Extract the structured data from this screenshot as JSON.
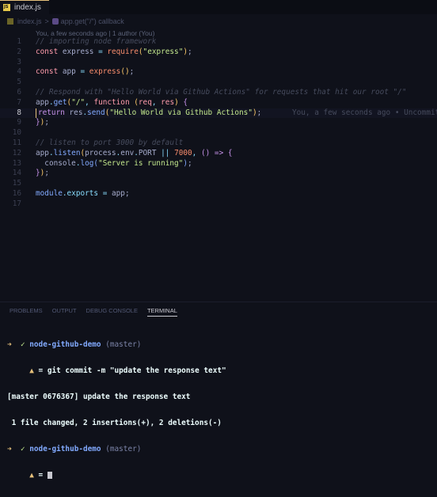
{
  "tab": {
    "label": "index.js"
  },
  "breadcrumb": {
    "file": "index.js",
    "separator": ">",
    "symbol": "app.get(\"/\") callback"
  },
  "blame_header": "You, a few seconds ago | 1 author (You)",
  "editor": {
    "line_numbers": [
      "1",
      "2",
      "3",
      "4",
      "5",
      "6",
      "7",
      "8",
      "9",
      "10",
      "11",
      "12",
      "13",
      "14",
      "15",
      "16",
      "17"
    ],
    "active_line": "8",
    "line8_blame": "You, a few seconds ago • Uncommit",
    "tokens": {
      "l1_comment": "// importing node framework",
      "kw_const": "const",
      "l2_express": "express",
      "eq": "=",
      "l2_require": "require",
      "paren_open": "(",
      "paren_close": ")",
      "l2_str": "\"express\"",
      "semi": ";",
      "l4_app": "app",
      "l4_express": "express",
      "l4_call": "()",
      "l6_comment": "// Respond with \"Hello World via Github Actions\" for requests that hit our root \"/\"",
      "l7_app": "app",
      "dot": ".",
      "l7_get": "get",
      "l7_str": "\"/\"",
      "comma": ",",
      "l7_function": "function",
      "l7_req": "req",
      "l7_res": "res",
      "brace_open": "{",
      "brace_close": "}",
      "l8_return": "return",
      "l8_res": "res",
      "l8_send": "send",
      "l8_str": "\"Hello World via Github Actions\"",
      "l11_comment": "// listen to port 3000 by default",
      "l12_app": "app",
      "l12_listen": "listen",
      "l12_process": "process",
      "l12_env": "env",
      "l12_port": "PORT",
      "l12_or": "||",
      "l12_num": "7000",
      "l12_arrow": "=>",
      "l13_console": "console",
      "l13_log": "log",
      "l13_str": "\"Server is running\"",
      "l16_module": "module",
      "l16_exports": "exports",
      "l16_app": "app"
    }
  },
  "panel": {
    "tabs": [
      "PROBLEMS",
      "OUTPUT",
      "DEBUG CONSOLE",
      "TERMINAL"
    ],
    "active_tab": "TERMINAL"
  },
  "terminal": {
    "arrow": "➜",
    "check": "✓",
    "dir": "node-github-demo",
    "branch": "(master)",
    "warn": "▲",
    "prompt_sym": "=",
    "command": "git commit -m \"update the response text\"",
    "out1": "[master 0676367] update the response text",
    "out2": " 1 file changed, 2 insertions(+), 2 deletions(-)"
  },
  "colors": {
    "background": "#0f111a",
    "keyword": "#c792ea",
    "string": "#c3e88d",
    "function": "#82aaff",
    "number": "#f78c6c",
    "comment": "#464b5d",
    "cursor_accent": "#e5c07b"
  }
}
